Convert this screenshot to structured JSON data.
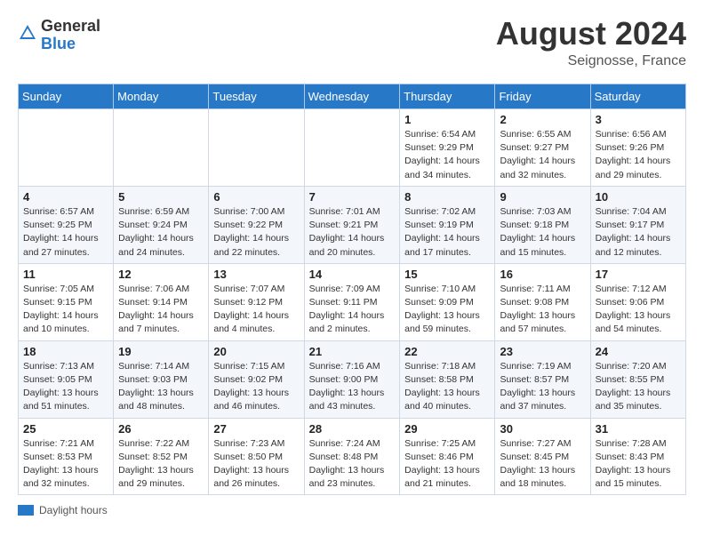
{
  "header": {
    "logo_general": "General",
    "logo_blue": "Blue",
    "month_year": "August 2024",
    "location": "Seignosse, France"
  },
  "footer": {
    "daylight_label": "Daylight hours"
  },
  "weekdays": [
    "Sunday",
    "Monday",
    "Tuesday",
    "Wednesday",
    "Thursday",
    "Friday",
    "Saturday"
  ],
  "weeks": [
    [
      {
        "day": "",
        "info": ""
      },
      {
        "day": "",
        "info": ""
      },
      {
        "day": "",
        "info": ""
      },
      {
        "day": "",
        "info": ""
      },
      {
        "day": "1",
        "info": "Sunrise: 6:54 AM\nSunset: 9:29 PM\nDaylight: 14 hours\nand 34 minutes."
      },
      {
        "day": "2",
        "info": "Sunrise: 6:55 AM\nSunset: 9:27 PM\nDaylight: 14 hours\nand 32 minutes."
      },
      {
        "day": "3",
        "info": "Sunrise: 6:56 AM\nSunset: 9:26 PM\nDaylight: 14 hours\nand 29 minutes."
      }
    ],
    [
      {
        "day": "4",
        "info": "Sunrise: 6:57 AM\nSunset: 9:25 PM\nDaylight: 14 hours\nand 27 minutes."
      },
      {
        "day": "5",
        "info": "Sunrise: 6:59 AM\nSunset: 9:24 PM\nDaylight: 14 hours\nand 24 minutes."
      },
      {
        "day": "6",
        "info": "Sunrise: 7:00 AM\nSunset: 9:22 PM\nDaylight: 14 hours\nand 22 minutes."
      },
      {
        "day": "7",
        "info": "Sunrise: 7:01 AM\nSunset: 9:21 PM\nDaylight: 14 hours\nand 20 minutes."
      },
      {
        "day": "8",
        "info": "Sunrise: 7:02 AM\nSunset: 9:19 PM\nDaylight: 14 hours\nand 17 minutes."
      },
      {
        "day": "9",
        "info": "Sunrise: 7:03 AM\nSunset: 9:18 PM\nDaylight: 14 hours\nand 15 minutes."
      },
      {
        "day": "10",
        "info": "Sunrise: 7:04 AM\nSunset: 9:17 PM\nDaylight: 14 hours\nand 12 minutes."
      }
    ],
    [
      {
        "day": "11",
        "info": "Sunrise: 7:05 AM\nSunset: 9:15 PM\nDaylight: 14 hours\nand 10 minutes."
      },
      {
        "day": "12",
        "info": "Sunrise: 7:06 AM\nSunset: 9:14 PM\nDaylight: 14 hours\nand 7 minutes."
      },
      {
        "day": "13",
        "info": "Sunrise: 7:07 AM\nSunset: 9:12 PM\nDaylight: 14 hours\nand 4 minutes."
      },
      {
        "day": "14",
        "info": "Sunrise: 7:09 AM\nSunset: 9:11 PM\nDaylight: 14 hours\nand 2 minutes."
      },
      {
        "day": "15",
        "info": "Sunrise: 7:10 AM\nSunset: 9:09 PM\nDaylight: 13 hours\nand 59 minutes."
      },
      {
        "day": "16",
        "info": "Sunrise: 7:11 AM\nSunset: 9:08 PM\nDaylight: 13 hours\nand 57 minutes."
      },
      {
        "day": "17",
        "info": "Sunrise: 7:12 AM\nSunset: 9:06 PM\nDaylight: 13 hours\nand 54 minutes."
      }
    ],
    [
      {
        "day": "18",
        "info": "Sunrise: 7:13 AM\nSunset: 9:05 PM\nDaylight: 13 hours\nand 51 minutes."
      },
      {
        "day": "19",
        "info": "Sunrise: 7:14 AM\nSunset: 9:03 PM\nDaylight: 13 hours\nand 48 minutes."
      },
      {
        "day": "20",
        "info": "Sunrise: 7:15 AM\nSunset: 9:02 PM\nDaylight: 13 hours\nand 46 minutes."
      },
      {
        "day": "21",
        "info": "Sunrise: 7:16 AM\nSunset: 9:00 PM\nDaylight: 13 hours\nand 43 minutes."
      },
      {
        "day": "22",
        "info": "Sunrise: 7:18 AM\nSunset: 8:58 PM\nDaylight: 13 hours\nand 40 minutes."
      },
      {
        "day": "23",
        "info": "Sunrise: 7:19 AM\nSunset: 8:57 PM\nDaylight: 13 hours\nand 37 minutes."
      },
      {
        "day": "24",
        "info": "Sunrise: 7:20 AM\nSunset: 8:55 PM\nDaylight: 13 hours\nand 35 minutes."
      }
    ],
    [
      {
        "day": "25",
        "info": "Sunrise: 7:21 AM\nSunset: 8:53 PM\nDaylight: 13 hours\nand 32 minutes."
      },
      {
        "day": "26",
        "info": "Sunrise: 7:22 AM\nSunset: 8:52 PM\nDaylight: 13 hours\nand 29 minutes."
      },
      {
        "day": "27",
        "info": "Sunrise: 7:23 AM\nSunset: 8:50 PM\nDaylight: 13 hours\nand 26 minutes."
      },
      {
        "day": "28",
        "info": "Sunrise: 7:24 AM\nSunset: 8:48 PM\nDaylight: 13 hours\nand 23 minutes."
      },
      {
        "day": "29",
        "info": "Sunrise: 7:25 AM\nSunset: 8:46 PM\nDaylight: 13 hours\nand 21 minutes."
      },
      {
        "day": "30",
        "info": "Sunrise: 7:27 AM\nSunset: 8:45 PM\nDaylight: 13 hours\nand 18 minutes."
      },
      {
        "day": "31",
        "info": "Sunrise: 7:28 AM\nSunset: 8:43 PM\nDaylight: 13 hours\nand 15 minutes."
      }
    ]
  ]
}
